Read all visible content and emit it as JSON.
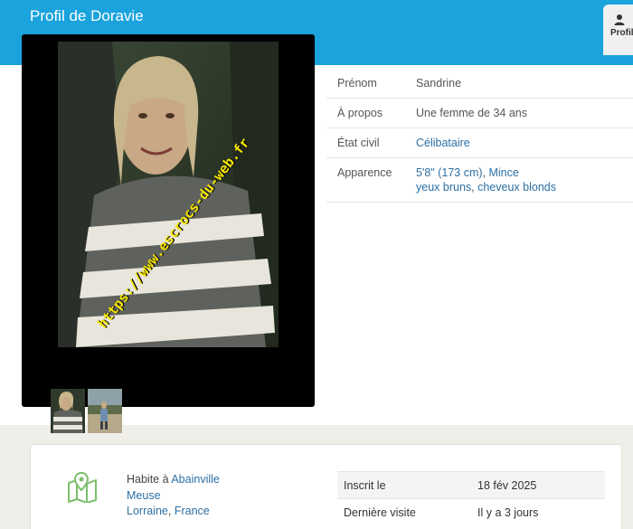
{
  "header": {
    "title": "Profil de Doravie",
    "tab_label": "Profil"
  },
  "photos": {
    "watermark": "https://www.escrocs-du-web.fr"
  },
  "info": [
    {
      "label": "Prénom",
      "value": "Sandrine"
    },
    {
      "label": "À propos",
      "value": "Une femme de 34 ans"
    },
    {
      "label": "État civil",
      "value": "Célibataire"
    },
    {
      "label": "Apparence",
      "value_line1_a": "5'8\" (173 cm)",
      "value_line1_sep": ", ",
      "value_line1_b": "Mince",
      "value_line2_a": "yeux bruns",
      "value_line2_sep": ", ",
      "value_line2_b": "cheveux blonds"
    }
  ],
  "location": {
    "prefix": "Habite à ",
    "city": "Abainville",
    "department": "Meuse",
    "region": "Lorraine",
    "separator": ", ",
    "country": "France"
  },
  "meta": [
    {
      "label": "Inscrit le",
      "value": "18 fév 2025"
    },
    {
      "label": "Dernière visite",
      "value": "Il y a 3 jours"
    }
  ],
  "colors": {
    "header": "#1aa3dd",
    "link": "#2c6fa3",
    "map_icon": "#7cbf6c",
    "watermark": "#f5e600"
  }
}
